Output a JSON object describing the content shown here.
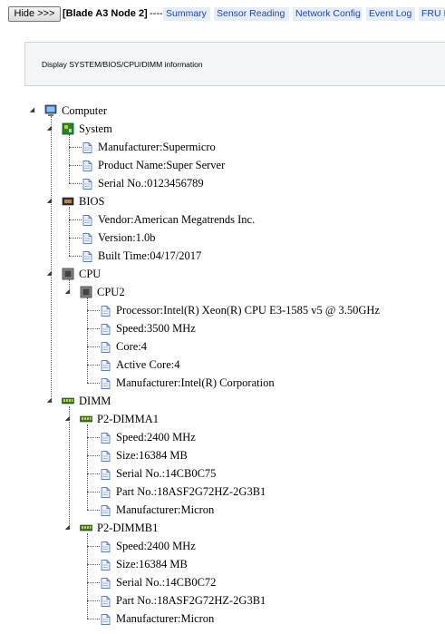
{
  "toolbar": {
    "hide_label": "Hide >>>",
    "node_title": "[Blade A3 Node 2]",
    "separator": "----",
    "tabs": [
      "Summary",
      "Sensor Reading",
      "Network Config",
      "Event Log",
      "FRU Info"
    ]
  },
  "info": {
    "text": "Display SYSTEM/BIOS/CPU/DIMM information"
  },
  "tree": {
    "root": "Computer",
    "system": {
      "label": "System",
      "items": [
        "Manufacturer:Supermicro",
        "Product Name:Super Server",
        "Serial No.:0123456789"
      ]
    },
    "bios": {
      "label": "BIOS",
      "items": [
        "Vendor:American Megatrends Inc.",
        "Version:1.0b",
        "Built Time:04/17/2017"
      ]
    },
    "cpu": {
      "label": "CPU",
      "cpu2": {
        "label": "CPU2",
        "items": [
          "Processor:Intel(R) Xeon(R) CPU E3-1585 v5 @ 3.50GHz",
          "Speed:3500 MHz",
          "Core:4",
          "Active Core:4",
          "Manufacturer:Intel(R) Corporation"
        ]
      }
    },
    "dimm": {
      "label": "DIMM",
      "dimma1": {
        "label": "P2-DIMMA1",
        "items": [
          "Speed:2400 MHz",
          "Size:16384 MB",
          "Serial No.:14CB0C75",
          "Part No.:18ASF2G72HZ-2G3B1",
          "Manufacturer:Micron"
        ]
      },
      "dimmb1": {
        "label": "P2-DIMMB1",
        "items": [
          "Speed:2400 MHz",
          "Size:16384 MB",
          "Serial No.:14CB0C72",
          "Part No.:18ASF2G72HZ-2G3B1",
          "Manufacturer:Micron"
        ]
      }
    }
  }
}
